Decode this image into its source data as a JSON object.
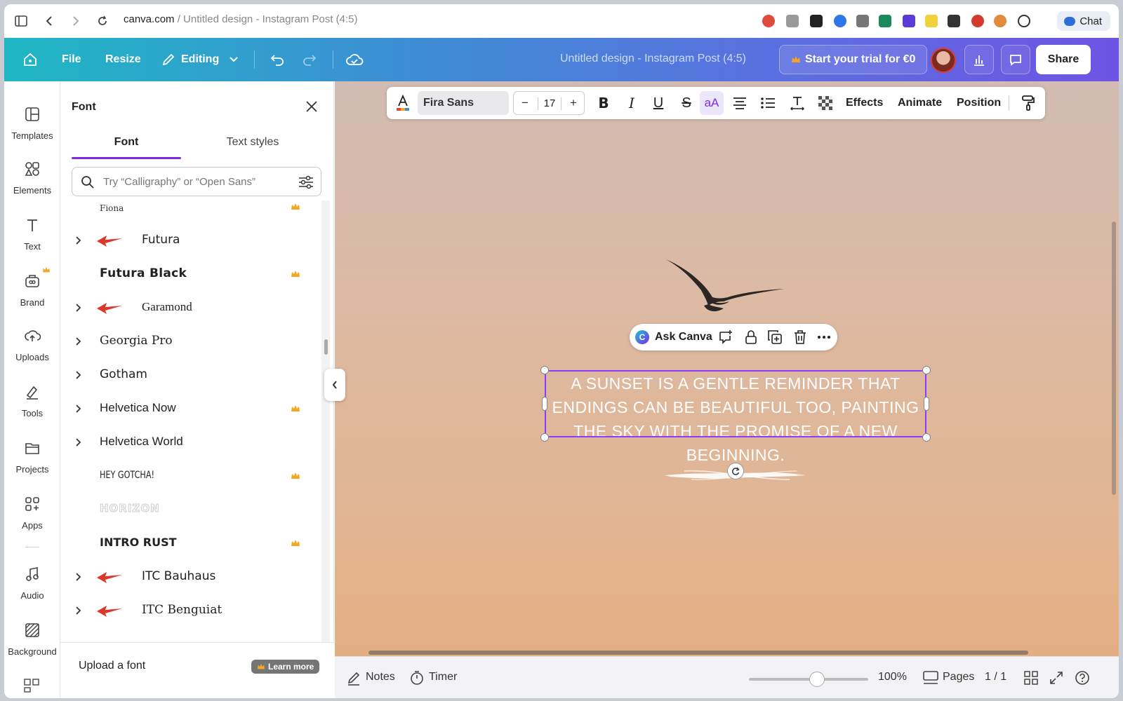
{
  "browser": {
    "url_host": "canva.com",
    "url_path": " / Untitled design - Instagram Post (4:5)",
    "chat_label": "Chat"
  },
  "topbar": {
    "file_label": "File",
    "resize_label": "Resize",
    "editing_label": "Editing",
    "doc_title": "Untitled design - Instagram Post (4:5)",
    "trial_label": "Start your trial for €0",
    "share_label": "Share"
  },
  "rail": {
    "items": [
      {
        "label": "Templates",
        "icon": "templates-icon"
      },
      {
        "label": "Elements",
        "icon": "elements-icon"
      },
      {
        "label": "Text",
        "icon": "text-icon"
      },
      {
        "label": "Brand",
        "icon": "brand-icon"
      },
      {
        "label": "Uploads",
        "icon": "uploads-icon"
      },
      {
        "label": "Tools",
        "icon": "tools-icon"
      },
      {
        "label": "Projects",
        "icon": "projects-icon"
      },
      {
        "label": "Apps",
        "icon": "apps-icon"
      },
      {
        "label": "Audio",
        "icon": "audio-icon"
      },
      {
        "label": "Background",
        "icon": "background-icon"
      }
    ]
  },
  "panel": {
    "title": "Font",
    "tabs": [
      {
        "label": "Font"
      },
      {
        "label": "Text styles"
      }
    ],
    "search_placeholder": "Try “Calligraphy” or “Open Sans”",
    "fonts": [
      {
        "name": "Fiona",
        "expandable": false,
        "pro": true,
        "flag": false
      },
      {
        "name": "Futura",
        "expandable": true,
        "pro": false,
        "flag": true
      },
      {
        "name": "Futura Black",
        "expandable": false,
        "pro": true,
        "flag": false
      },
      {
        "name": "Garamond",
        "expandable": true,
        "pro": false,
        "flag": true
      },
      {
        "name": "Georgia Pro",
        "expandable": true,
        "pro": false,
        "flag": false
      },
      {
        "name": "Gotham",
        "expandable": true,
        "pro": false,
        "flag": false
      },
      {
        "name": "Helvetica Now",
        "expandable": true,
        "pro": true,
        "flag": false
      },
      {
        "name": "Helvetica World",
        "expandable": true,
        "pro": false,
        "flag": false
      },
      {
        "name": "HEY GOTCHA!",
        "expandable": false,
        "pro": true,
        "flag": false
      },
      {
        "name": "HORIZON",
        "expandable": false,
        "pro": false,
        "flag": false
      },
      {
        "name": "INTRO RUST",
        "expandable": false,
        "pro": true,
        "flag": false
      },
      {
        "name": "ITC Bauhaus",
        "expandable": true,
        "pro": false,
        "flag": true
      },
      {
        "name": "ITC Benguiat",
        "expandable": true,
        "pro": false,
        "flag": true
      }
    ],
    "upload_label": "Upload a font",
    "learn_more_label": "Learn more"
  },
  "toolbar": {
    "font_family": "Fira Sans",
    "font_size": "17",
    "effects_label": "Effects",
    "animate_label": "Animate",
    "position_label": "Position"
  },
  "askbar": {
    "label": "Ask Canva"
  },
  "canvas": {
    "quote": "A SUNSET IS A GENTLE REMINDER THAT ENDINGS CAN BE BEAUTIFUL TOO, PAINTING THE SKY WITH THE PROMISE OF A NEW BEGINNING."
  },
  "bottombar": {
    "notes_label": "Notes",
    "timer_label": "Timer",
    "zoom": "100%",
    "pages_label": "Pages",
    "page_count": "1 / 1"
  },
  "colors": {
    "accent": "#7d2ae8",
    "selection": "#8b3dff",
    "crown": "#f5a623"
  }
}
